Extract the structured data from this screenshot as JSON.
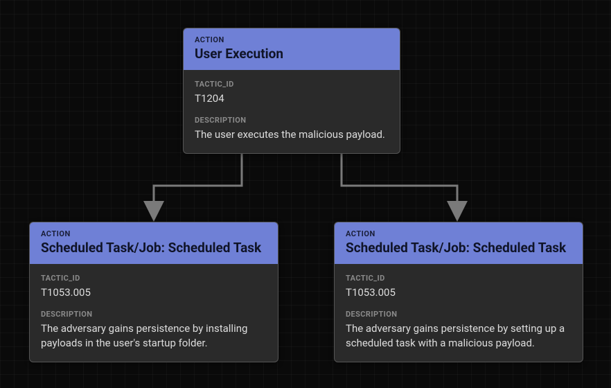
{
  "labels": {
    "action": "ACTION",
    "tactic_id": "TACTIC_ID",
    "description": "DESCRIPTION"
  },
  "nodes": {
    "root": {
      "title": "User Execution",
      "tactic_id": "T1204",
      "description": "The user executes the malicious payload."
    },
    "left": {
      "title": "Scheduled Task/Job: Scheduled Task",
      "tactic_id": "T1053.005",
      "description": "The adversary gains persistence by installing payloads in the user's startup folder."
    },
    "right": {
      "title": "Scheduled Task/Job: Scheduled Task",
      "tactic_id": "T1053.005",
      "description": "The adversary gains persistence by setting up a scheduled task with a malicious payload."
    }
  }
}
